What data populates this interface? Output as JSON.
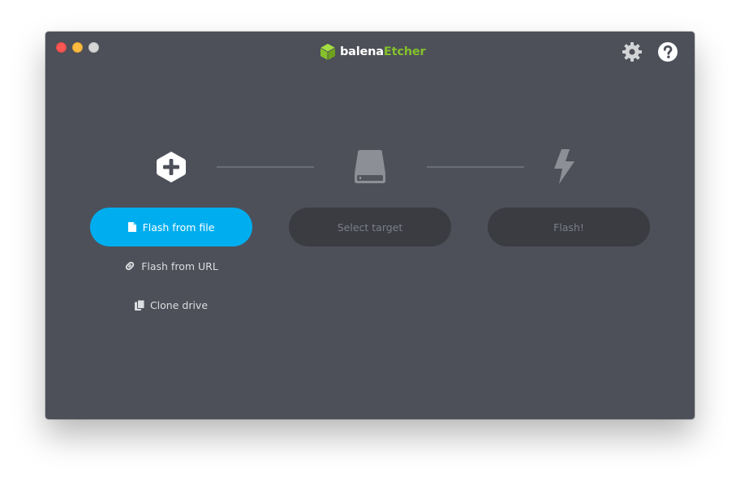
{
  "app": {
    "brand_prefix": "balena",
    "brand_suffix": "Etcher"
  },
  "titlebar": {
    "icons": [
      "settings-gear-icon",
      "help-icon"
    ]
  },
  "steps": {
    "source": {
      "icon": "plus-hexagon-icon",
      "primary_button": "Flash from file",
      "link_url": "Flash from URL",
      "link_clone": "Clone drive"
    },
    "target": {
      "icon": "drive-icon",
      "button": "Select target"
    },
    "flash": {
      "icon": "lightning-bolt-icon",
      "button": "Flash!"
    }
  },
  "colors": {
    "window_bg": "#4d5059",
    "accent": "#00aeef",
    "brand_green": "#85c12b",
    "disabled_pill": "#3a3c41",
    "disabled_text": "#7c7f86"
  }
}
